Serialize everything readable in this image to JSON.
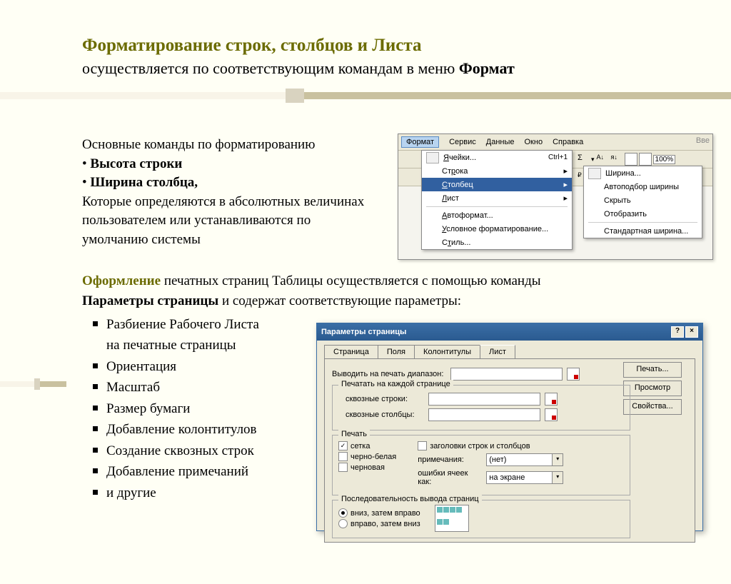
{
  "title": "Форматирование строк, столбцов и Листа",
  "subtitle_a": "осуществляется   по соответствующим командам в меню ",
  "subtitle_b": "Формат",
  "left": {
    "l1": "Основные команды по форматированию",
    "l2": "Высота строки",
    "l3": "Ширина столбца,",
    "l4": "Которые определяются в абсолютных величинах пользователем или устанавливаются по умолчанию системы"
  },
  "ofor": {
    "h": "Оформление",
    "t1": " печатных страниц Таблицы осуществляется с помощью команды ",
    "t2": "Параметры страницы",
    "t3": " и содержат соответствующие параметры:"
  },
  "list2": [
    "Разбиение Рабочего Листа",
    "на печатные страницы",
    "Ориентация",
    "Масштаб",
    "Размер бумаги",
    "Добавление колонтитулов",
    "Создание сквозных строк",
    "Добавление примечаний",
    "и другие"
  ],
  "menubar": [
    "Формат",
    "Сервис",
    "Данные",
    "Окно",
    "Справка"
  ],
  "vve": "Вве",
  "zoom": "100%",
  "dropdown": [
    {
      "label": "Ячейки...",
      "shortcut": "Ctrl+1"
    },
    {
      "label": "Строка",
      "arrow": true
    },
    {
      "label": "Столбец",
      "arrow": true,
      "highlight": true
    },
    {
      "label": "Лист",
      "arrow": true
    },
    {
      "sep": true
    },
    {
      "label": "Автоформат..."
    },
    {
      "label": "Условное форматирование..."
    },
    {
      "label": "Стиль..."
    }
  ],
  "submenu": [
    "Ширина...",
    "Автоподбор ширины",
    "Скрыть",
    "Отобразить",
    "Стандартная ширина..."
  ],
  "dlg": {
    "title": "Параметры страницы",
    "tabs": [
      "Страница",
      "Поля",
      "Колонтитулы",
      "Лист"
    ],
    "active_tab": 3,
    "range_label": "Выводить на печать диапазон:",
    "each_page": "Печатать на каждой странице",
    "rows": "сквозные строки:",
    "cols": "сквозные столбцы:",
    "print": "Печать",
    "cb_grid": "сетка",
    "cb_bw": "черно-белая",
    "cb_draft": "черновая",
    "cb_head": "заголовки строк и столбцов",
    "notes": "примечания:",
    "notes_val": "(нет)",
    "errors": "ошибки ячеек как:",
    "errors_val": "на экране",
    "order": "Последовательность вывода страниц",
    "rb1": "вниз, затем вправо",
    "rb2": "вправо, затем вниз",
    "btn_print": "Печать...",
    "btn_preview": "Просмотр",
    "btn_props": "Свойства..."
  }
}
